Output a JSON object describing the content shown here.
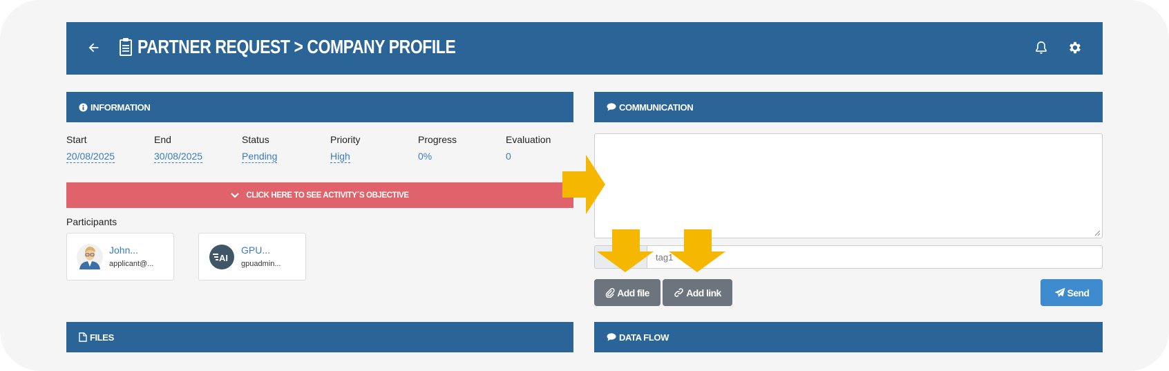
{
  "header": {
    "title": "PARTNER REQUEST > COMPANY PROFILE",
    "icons": [
      "back-arrow-icon",
      "clipboard-icon",
      "bell-icon",
      "gear-icon"
    ]
  },
  "information": {
    "title": "INFORMATION",
    "fields": [
      {
        "label": "Start",
        "value": "20/08/2025"
      },
      {
        "label": "End",
        "value": "30/08/2025"
      },
      {
        "label": "Status",
        "value": "Pending"
      },
      {
        "label": "Priority",
        "value": "High"
      },
      {
        "label": "Progress",
        "value": "0%"
      },
      {
        "label": "Evaluation",
        "value": "0"
      }
    ],
    "objective_button": "CLICK HERE TO SEE ACTIVITY´S OBJECTIVE",
    "participants_label": "Participants",
    "participants": [
      {
        "name": "John...",
        "email": "applicant@..."
      },
      {
        "name": "GPU...",
        "email": "gpuadmin..."
      }
    ]
  },
  "communication": {
    "title": "COMMUNICATION",
    "message_value": "",
    "tag_value": "tag1",
    "add_file_label": "Add file",
    "add_link_label": "Add link",
    "send_label": "Send"
  },
  "files": {
    "title": "FILES"
  },
  "data_flow": {
    "title": "DATA FLOW"
  },
  "colors": {
    "header": "#2b6597",
    "objective": "#e0636b",
    "link": "#3a7cc0",
    "secondary_button": "#6c757d",
    "send_button": "#3f8bd0",
    "annotation_arrow": "#f5b700"
  }
}
